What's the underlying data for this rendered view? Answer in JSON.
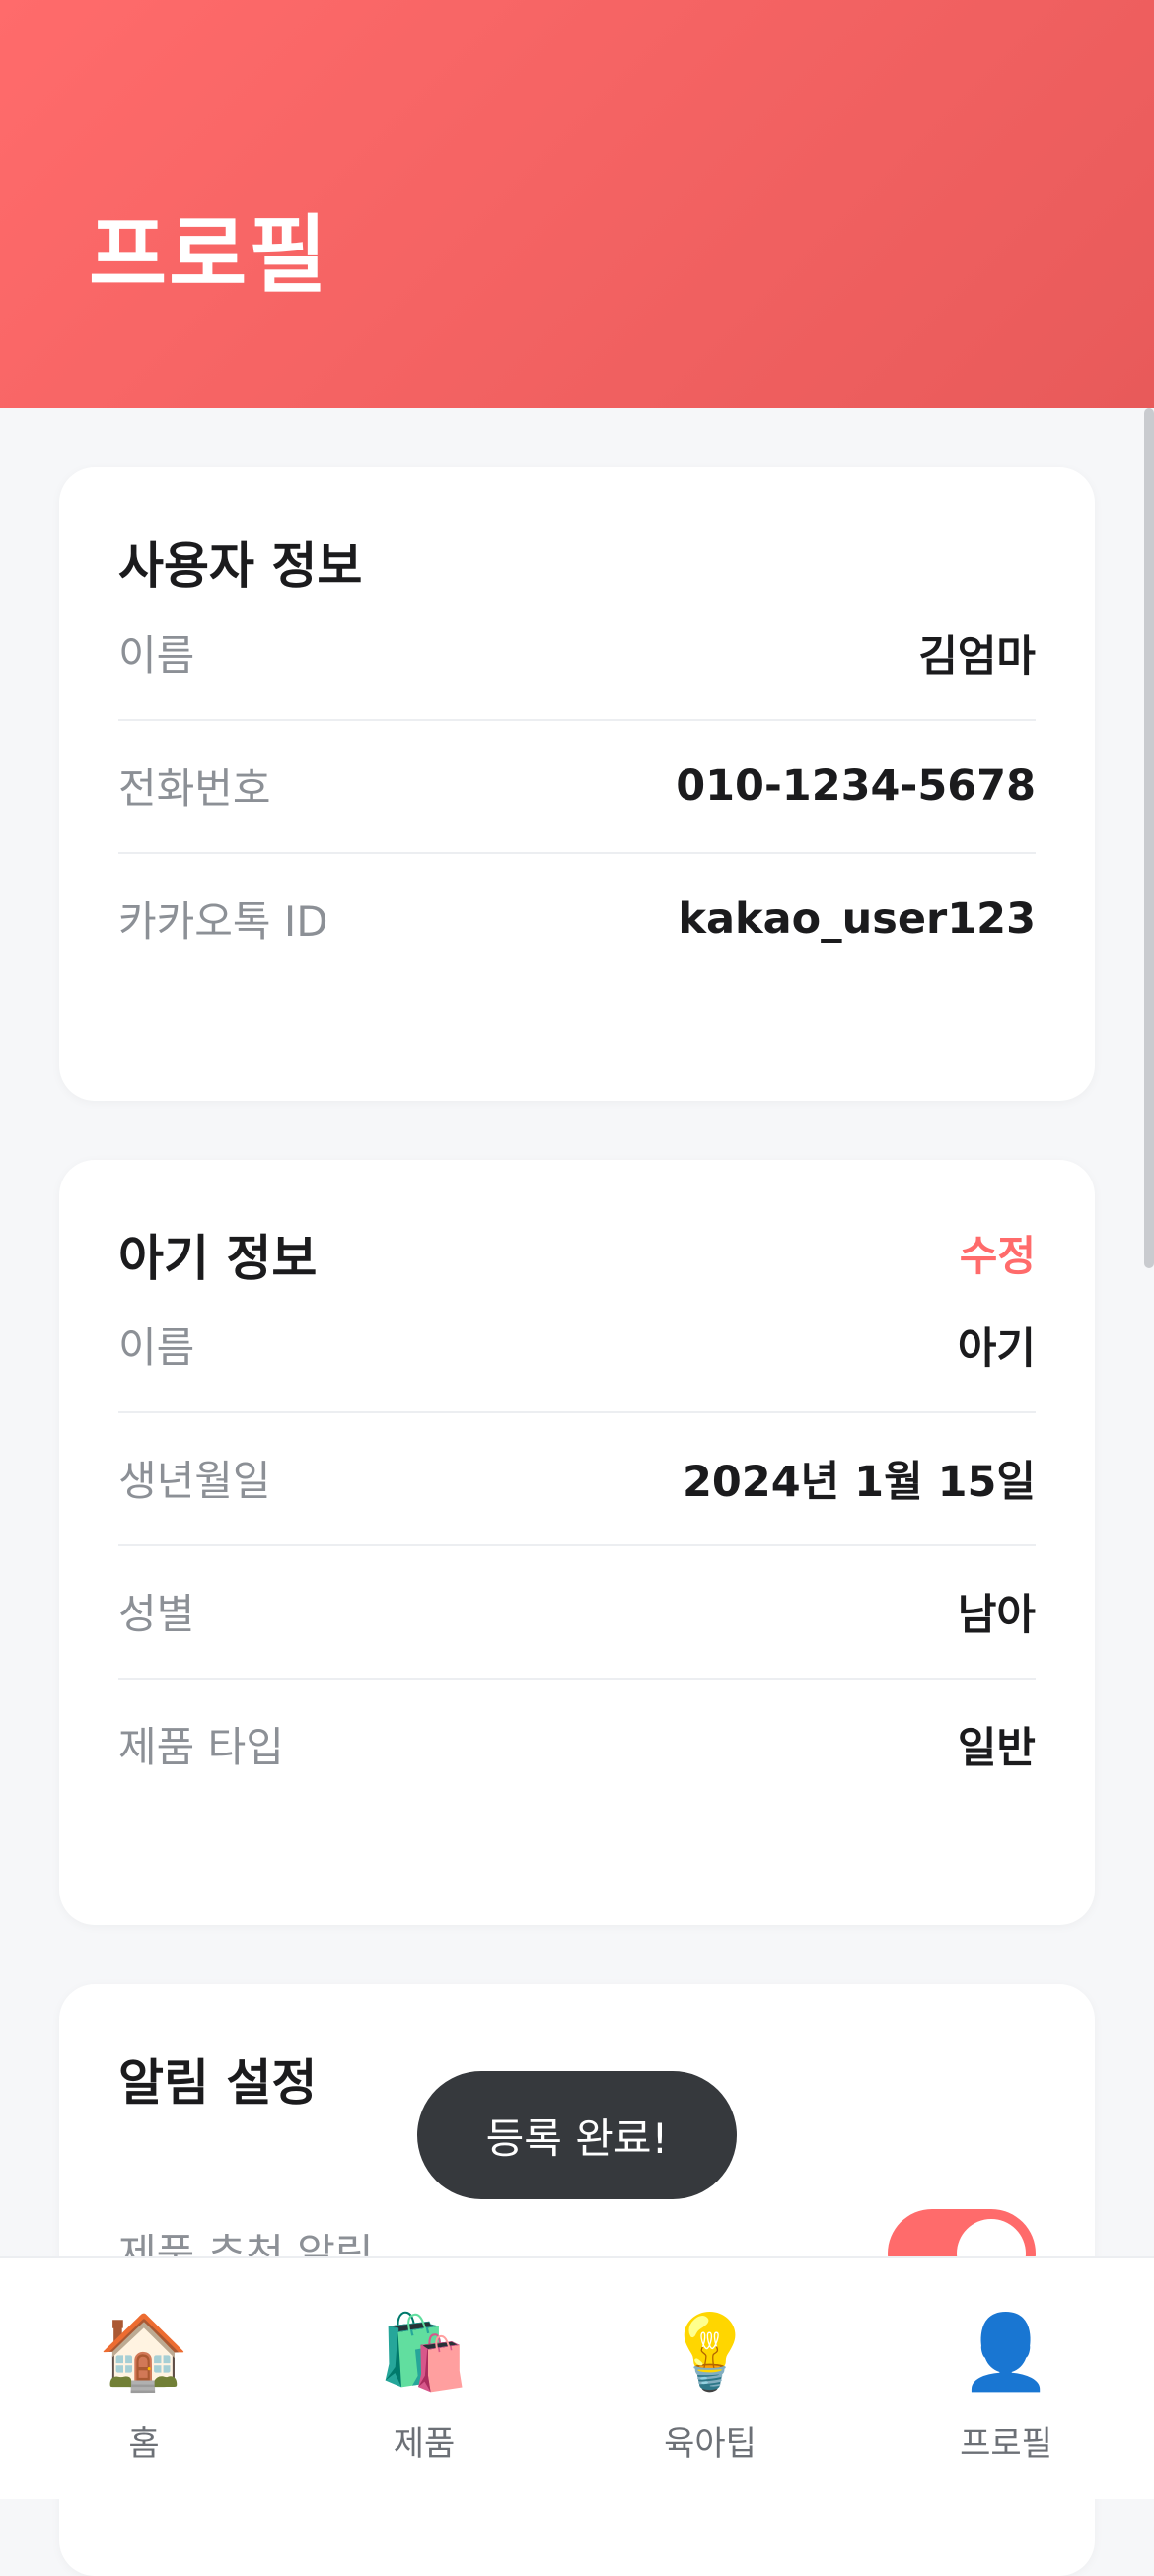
{
  "header": {
    "title": "프로필"
  },
  "user_info": {
    "title": "사용자 정보",
    "rows": [
      {
        "label": "이름",
        "value": "김엄마"
      },
      {
        "label": "전화번호",
        "value": "010-1234-5678"
      },
      {
        "label": "카카오톡 ID",
        "value": "kakao_user123"
      }
    ]
  },
  "baby_info": {
    "title": "아기 정보",
    "edit_label": "수정",
    "rows": [
      {
        "label": "이름",
        "value": "아기"
      },
      {
        "label": "생년월일",
        "value": "2024년 1월 15일"
      },
      {
        "label": "성별",
        "value": "남아"
      },
      {
        "label": "제품 타입",
        "value": "일반"
      }
    ]
  },
  "notifications": {
    "title": "알림 설정",
    "rows": [
      {
        "label": "제품 추천 알림",
        "enabled": true
      }
    ]
  },
  "toast": {
    "message": "등록 완료!"
  },
  "tabbar": {
    "tabs": [
      {
        "label": "홈",
        "icon": "house-icon",
        "glyph": "🏠"
      },
      {
        "label": "제품",
        "icon": "shopping-bags-icon",
        "glyph": "🛍️"
      },
      {
        "label": "육아팁",
        "icon": "lightbulb-icon",
        "glyph": "💡"
      },
      {
        "label": "프로필",
        "icon": "user-silhouette-icon",
        "glyph": "👤"
      }
    ]
  },
  "colors": {
    "accent": "#ff6b6b",
    "header_gradient_start": "#ff6b6b",
    "header_gradient_end": "#e85a5a",
    "toast_bg": "#36393d"
  }
}
